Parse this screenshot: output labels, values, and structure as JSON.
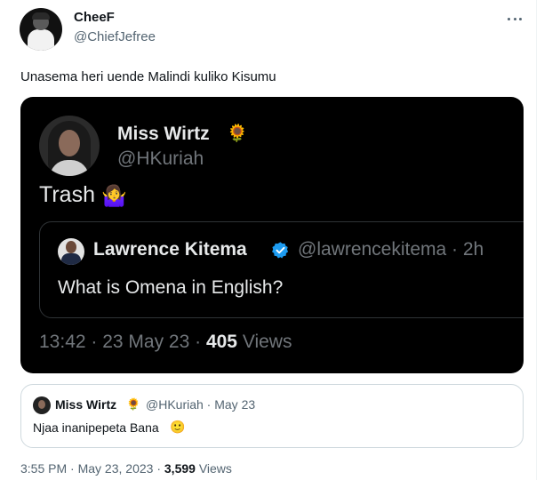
{
  "tweet": {
    "author_name": "CheeF",
    "author_handle": "@ChiefJefree",
    "text": "Unasema heri uende Malindi kuliko Kisumu",
    "footer": {
      "time": "3:55 PM",
      "date": "May 23, 2023",
      "views_count": "3,599",
      "views_label": "Views"
    }
  },
  "image_card": {
    "name": "Miss Wirtz",
    "name_emoji": "🌻",
    "handle": "@HKuriah",
    "text": "Trash",
    "text_emoji": "🤷‍♀️",
    "quoted": {
      "name": "Lawrence Kitema",
      "handle_time": "@lawrencekitema · 2h",
      "text": "What is Omena in English?"
    },
    "meta_time": "13:42 · 23 May 23 · ",
    "meta_views_count": "405",
    "meta_views_label": " Views"
  },
  "quote": {
    "name": "Miss Wirtz",
    "name_emoji": "🌻",
    "meta": "@HKuriah · May 23",
    "text": "Njaa inanipepeta Bana",
    "text_emoji": "🙂"
  },
  "colors": {
    "verified": "#1d9bf0",
    "muted_text": "#536471",
    "dark_bg": "#000000"
  },
  "icons": [
    "more-icon",
    "verified-icon",
    "sunflower-icon",
    "shrug-icon",
    "smile-icon"
  ]
}
